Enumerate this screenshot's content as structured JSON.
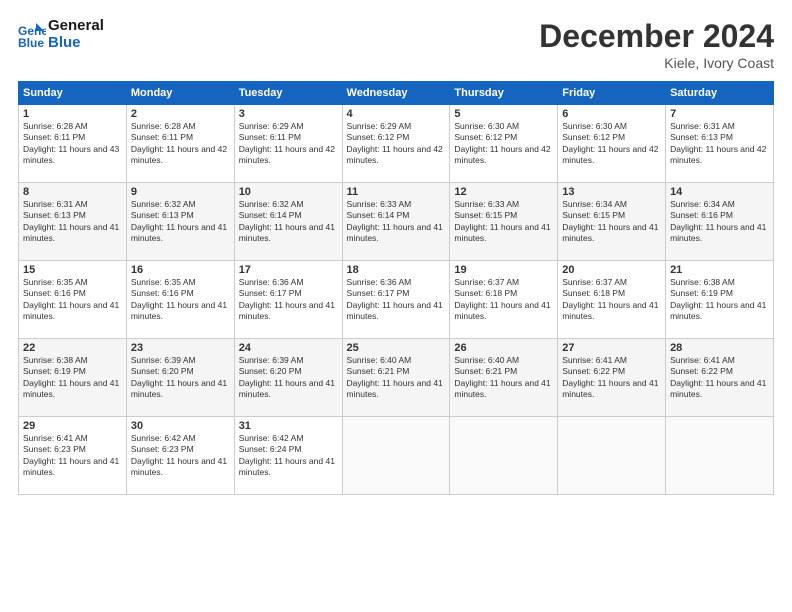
{
  "header": {
    "logo_line1": "General",
    "logo_line2": "Blue",
    "month_title": "December 2024",
    "location": "Kiele, Ivory Coast"
  },
  "days_of_week": [
    "Sunday",
    "Monday",
    "Tuesday",
    "Wednesday",
    "Thursday",
    "Friday",
    "Saturday"
  ],
  "weeks": [
    [
      {
        "num": "1",
        "rise": "6:28 AM",
        "set": "6:11 PM",
        "daylight": "11 hours and 43 minutes."
      },
      {
        "num": "2",
        "rise": "6:28 AM",
        "set": "6:11 PM",
        "daylight": "11 hours and 42 minutes."
      },
      {
        "num": "3",
        "rise": "6:29 AM",
        "set": "6:11 PM",
        "daylight": "11 hours and 42 minutes."
      },
      {
        "num": "4",
        "rise": "6:29 AM",
        "set": "6:12 PM",
        "daylight": "11 hours and 42 minutes."
      },
      {
        "num": "5",
        "rise": "6:30 AM",
        "set": "6:12 PM",
        "daylight": "11 hours and 42 minutes."
      },
      {
        "num": "6",
        "rise": "6:30 AM",
        "set": "6:12 PM",
        "daylight": "11 hours and 42 minutes."
      },
      {
        "num": "7",
        "rise": "6:31 AM",
        "set": "6:13 PM",
        "daylight": "11 hours and 42 minutes."
      }
    ],
    [
      {
        "num": "8",
        "rise": "6:31 AM",
        "set": "6:13 PM",
        "daylight": "11 hours and 41 minutes."
      },
      {
        "num": "9",
        "rise": "6:32 AM",
        "set": "6:13 PM",
        "daylight": "11 hours and 41 minutes."
      },
      {
        "num": "10",
        "rise": "6:32 AM",
        "set": "6:14 PM",
        "daylight": "11 hours and 41 minutes."
      },
      {
        "num": "11",
        "rise": "6:33 AM",
        "set": "6:14 PM",
        "daylight": "11 hours and 41 minutes."
      },
      {
        "num": "12",
        "rise": "6:33 AM",
        "set": "6:15 PM",
        "daylight": "11 hours and 41 minutes."
      },
      {
        "num": "13",
        "rise": "6:34 AM",
        "set": "6:15 PM",
        "daylight": "11 hours and 41 minutes."
      },
      {
        "num": "14",
        "rise": "6:34 AM",
        "set": "6:16 PM",
        "daylight": "11 hours and 41 minutes."
      }
    ],
    [
      {
        "num": "15",
        "rise": "6:35 AM",
        "set": "6:16 PM",
        "daylight": "11 hours and 41 minutes."
      },
      {
        "num": "16",
        "rise": "6:35 AM",
        "set": "6:16 PM",
        "daylight": "11 hours and 41 minutes."
      },
      {
        "num": "17",
        "rise": "6:36 AM",
        "set": "6:17 PM",
        "daylight": "11 hours and 41 minutes."
      },
      {
        "num": "18",
        "rise": "6:36 AM",
        "set": "6:17 PM",
        "daylight": "11 hours and 41 minutes."
      },
      {
        "num": "19",
        "rise": "6:37 AM",
        "set": "6:18 PM",
        "daylight": "11 hours and 41 minutes."
      },
      {
        "num": "20",
        "rise": "6:37 AM",
        "set": "6:18 PM",
        "daylight": "11 hours and 41 minutes."
      },
      {
        "num": "21",
        "rise": "6:38 AM",
        "set": "6:19 PM",
        "daylight": "11 hours and 41 minutes."
      }
    ],
    [
      {
        "num": "22",
        "rise": "6:38 AM",
        "set": "6:19 PM",
        "daylight": "11 hours and 41 minutes."
      },
      {
        "num": "23",
        "rise": "6:39 AM",
        "set": "6:20 PM",
        "daylight": "11 hours and 41 minutes."
      },
      {
        "num": "24",
        "rise": "6:39 AM",
        "set": "6:20 PM",
        "daylight": "11 hours and 41 minutes."
      },
      {
        "num": "25",
        "rise": "6:40 AM",
        "set": "6:21 PM",
        "daylight": "11 hours and 41 minutes."
      },
      {
        "num": "26",
        "rise": "6:40 AM",
        "set": "6:21 PM",
        "daylight": "11 hours and 41 minutes."
      },
      {
        "num": "27",
        "rise": "6:41 AM",
        "set": "6:22 PM",
        "daylight": "11 hours and 41 minutes."
      },
      {
        "num": "28",
        "rise": "6:41 AM",
        "set": "6:22 PM",
        "daylight": "11 hours and 41 minutes."
      }
    ],
    [
      {
        "num": "29",
        "rise": "6:41 AM",
        "set": "6:23 PM",
        "daylight": "11 hours and 41 minutes."
      },
      {
        "num": "30",
        "rise": "6:42 AM",
        "set": "6:23 PM",
        "daylight": "11 hours and 41 minutes."
      },
      {
        "num": "31",
        "rise": "6:42 AM",
        "set": "6:24 PM",
        "daylight": "11 hours and 41 minutes."
      },
      null,
      null,
      null,
      null
    ]
  ]
}
